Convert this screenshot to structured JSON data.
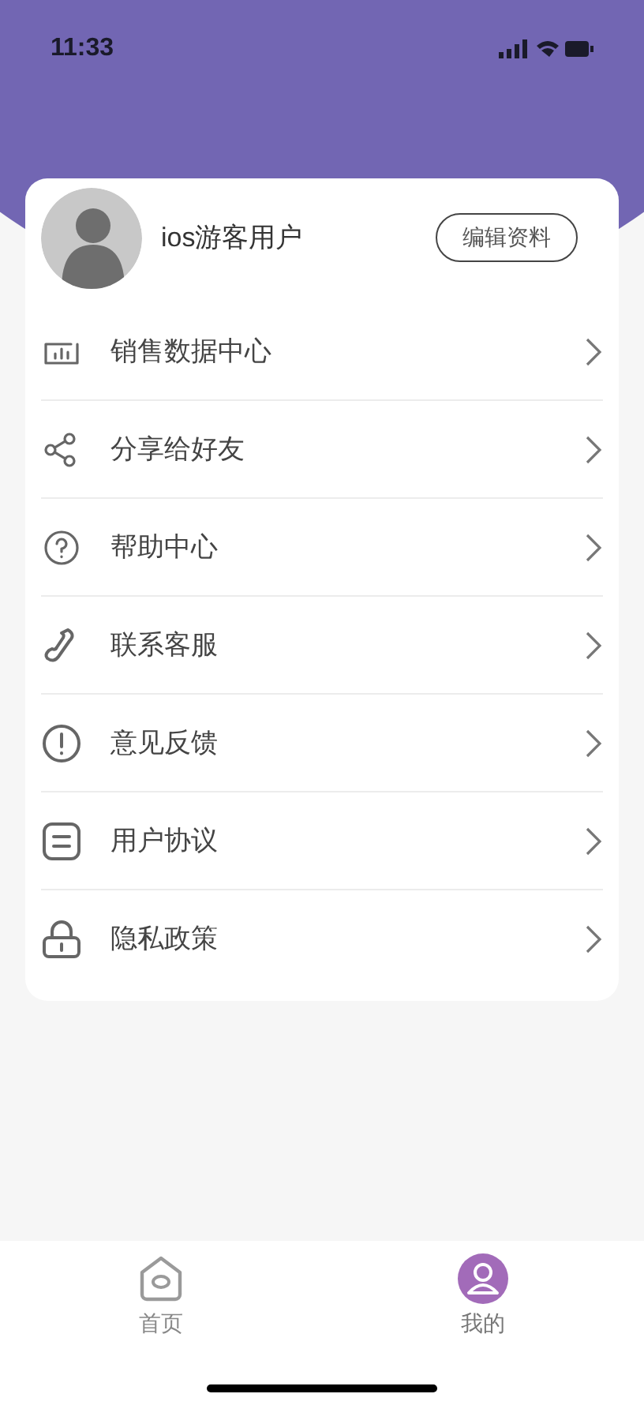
{
  "status_bar": {
    "time": "11:33"
  },
  "profile": {
    "name": "ios游客用户",
    "edit_button": "编辑资料"
  },
  "menu": [
    {
      "label": "销售数据中心"
    },
    {
      "label": "分享给好友"
    },
    {
      "label": "帮助中心"
    },
    {
      "label": "联系客服"
    },
    {
      "label": "意见反馈"
    },
    {
      "label": "用户协议"
    },
    {
      "label": "隐私政策"
    }
  ],
  "tab_bar": [
    {
      "label": "首页",
      "selected": false
    },
    {
      "label": "我的",
      "selected": true
    }
  ]
}
